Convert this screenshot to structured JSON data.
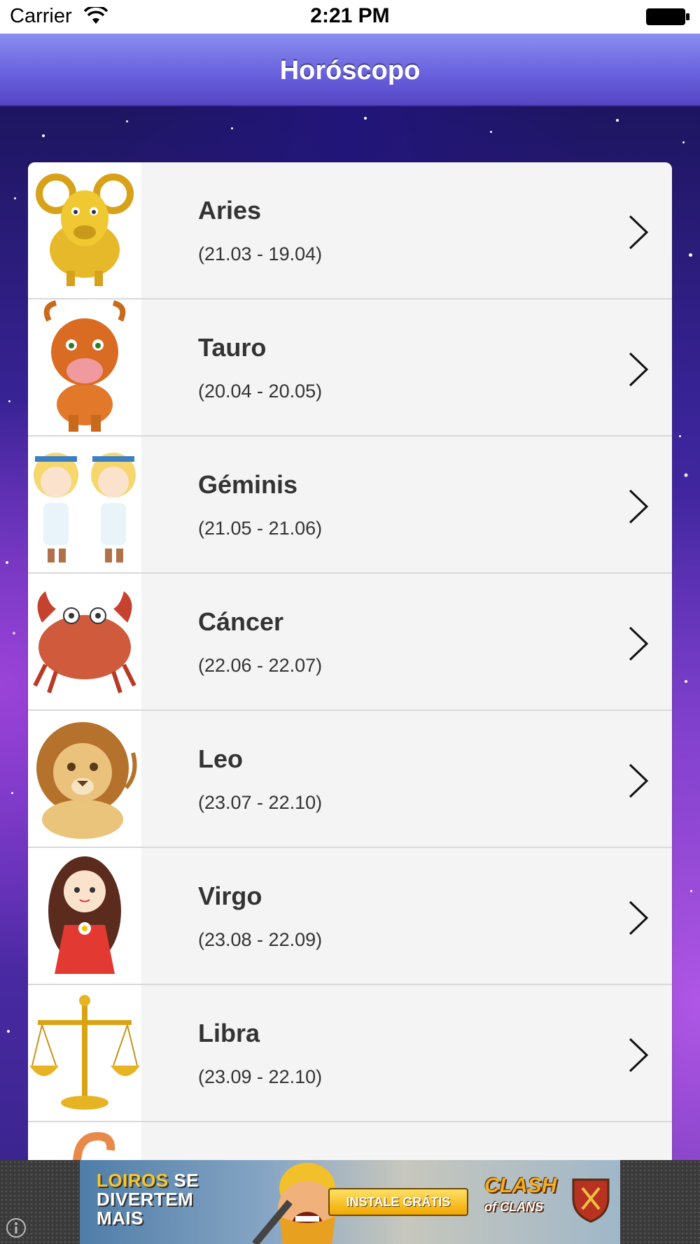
{
  "status_bar": {
    "carrier": "Carrier",
    "time": "2:21 PM"
  },
  "nav": {
    "title": "Horóscopo"
  },
  "signs": [
    {
      "name": "Aries",
      "dates": "(21.03 - 19.04)",
      "icon": "aries-ram-icon"
    },
    {
      "name": "Tauro",
      "dates": "(20.04 - 20.05)",
      "icon": "taurus-bull-icon"
    },
    {
      "name": "Géminis",
      "dates": "(21.05 - 21.06)",
      "icon": "gemini-twins-icon"
    },
    {
      "name": "Cáncer",
      "dates": "(22.06 - 22.07)",
      "icon": "cancer-crab-icon"
    },
    {
      "name": "Leo",
      "dates": "(23.07 - 22.10)",
      "icon": "leo-lion-icon"
    },
    {
      "name": "Virgo",
      "dates": "(23.08 - 22.09)",
      "icon": "virgo-maiden-icon"
    },
    {
      "name": "Libra",
      "dates": "(23.09 - 22.10)",
      "icon": "libra-scales-icon"
    },
    {
      "name": "",
      "dates": "",
      "icon": "scorpio-scorpion-icon"
    }
  ],
  "ad": {
    "headline_highlight": "LOIROS",
    "headline_rest": " SE DIVERTEM MAIS",
    "cta": "INSTALE GRÁTIS",
    "brand_main": "CLASH",
    "brand_sub": "of CLANS"
  },
  "colors": {
    "nav_gradient_top": "#8a8ef0",
    "nav_gradient_bottom": "#5646c4",
    "row_background": "#f4f4f4",
    "text": "#333333"
  }
}
